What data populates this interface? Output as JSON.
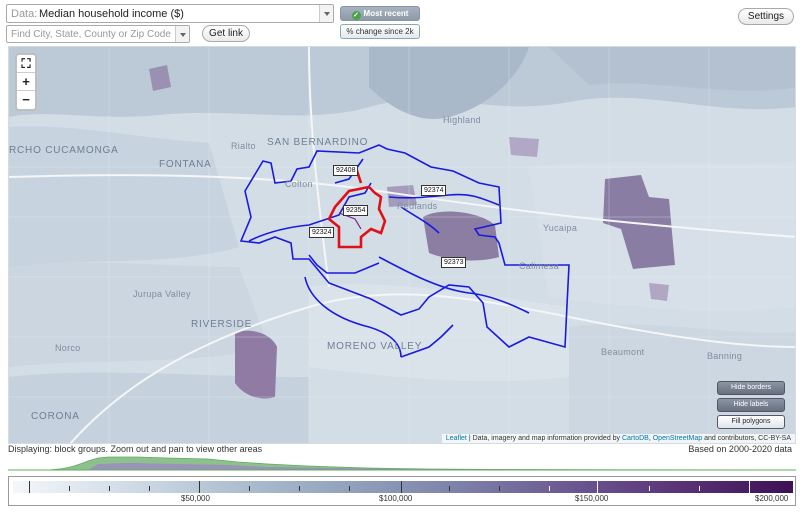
{
  "toolbar": {
    "data_prefix": "Data:",
    "data_value": "Median household income ($)",
    "location_placeholder": "Find City, State, County or Zip Code",
    "get_link": "Get link",
    "most_recent": "Most recent value",
    "pct_change": "% change since 2k",
    "settings": "Settings"
  },
  "map": {
    "zoom_extent_icon": "fullscreen-icon",
    "zoom_in": "+",
    "zoom_out": "−",
    "places": {
      "san_bernardino": "SAN BERNARDINO",
      "fontana": "FONTANA",
      "rancho": "RCHO CUCAMONGA",
      "rialto": "Rialto",
      "colton": "Colton",
      "highland": "Highland",
      "redlands": "Redlands",
      "yucaipa": "Yucaipa",
      "calimesa": "Calimesa",
      "jurupa": "Jurupa Valley",
      "riverside": "RIVERSIDE",
      "norco": "Norco",
      "moreno": "MORENO VALLEY",
      "beaumont": "Beaumont",
      "banning": "Banning",
      "corona": "CORONA"
    },
    "zips": [
      "92408",
      "92374",
      "92354",
      "92324",
      "92373"
    ],
    "buttons": {
      "hide_borders": "Hide borders",
      "hide_labels": "Hide labels",
      "fill_polygons": "Fill polygons"
    },
    "attribution_leaflet": "Leaflet",
    "attribution_text": " | Data, imagery and map information provided by ",
    "attribution_carto": "CartoDB",
    "attribution_sep": ", ",
    "attribution_osm": "OpenStreetMap",
    "attribution_tail": " and contributors, CC-BY-SA"
  },
  "footer": {
    "displaying": "Displaying: block groups. Zoom out and pan to view other areas",
    "based_on": "Based on 2000-2020 data"
  },
  "legend": {
    "labels": [
      "$50,000",
      "$100,000",
      "$150,000",
      "$200,000"
    ]
  },
  "colors": {
    "zip_border": "#1a1adf",
    "highlight_border": "#e0101a",
    "histogram_green": "#5fae5f",
    "histogram_purple": "#7a5aa6"
  }
}
